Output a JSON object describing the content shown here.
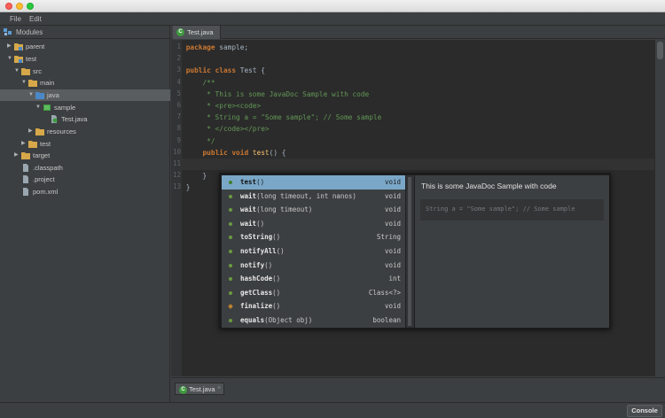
{
  "menubar": {
    "file": "File",
    "edit": "Edit"
  },
  "left_panel": {
    "title": "Modules",
    "tree": [
      {
        "label": "parent",
        "expanded": false,
        "icon": "module-folder-icon"
      },
      {
        "label": "test",
        "expanded": true,
        "icon": "module-folder-icon"
      },
      {
        "label": "src",
        "expanded": true,
        "icon": "folder-icon"
      },
      {
        "label": "main",
        "expanded": true,
        "icon": "folder-icon"
      },
      {
        "label": "java",
        "expanded": true,
        "icon": "source-folder-icon",
        "selected": true
      },
      {
        "label": "sample",
        "expanded": true,
        "icon": "package-icon"
      },
      {
        "label": "Test.java",
        "icon": "java-file-icon"
      },
      {
        "label": "resources",
        "expanded": false,
        "icon": "folder-icon"
      },
      {
        "label": "test",
        "expanded": false,
        "icon": "folder-icon"
      },
      {
        "label": "target",
        "expanded": false,
        "icon": "folder-icon"
      },
      {
        "label": ".classpath",
        "icon": "file-icon"
      },
      {
        "label": ".project",
        "icon": "file-icon"
      },
      {
        "label": "pom.xml",
        "icon": "file-icon"
      }
    ]
  },
  "editor": {
    "tab_label": "Test.java",
    "line_numbers": [
      "1",
      "2",
      "3",
      "4",
      "5",
      "6",
      "7",
      "8",
      "9",
      "10",
      "11",
      "12",
      "13"
    ],
    "lines": [
      "package sample;",
      "",
      "public class Test {",
      "    /**",
      "     * This is some JavaDoc Sample with code",
      "     * <pre><code>",
      "     * String a = \"Some sample\"; // Some sample",
      "     * </code></pre>",
      "     */",
      "    public void test() {",
      "",
      "    }",
      "}"
    ],
    "bottom_tab_label": "Test.java",
    "bottom_tab_close": "×"
  },
  "completion": {
    "items": [
      {
        "name": "test",
        "params": "()",
        "returns": "void",
        "selected": true
      },
      {
        "name": "wait",
        "params": "(long timeout, int nanos)",
        "returns": "void"
      },
      {
        "name": "wait",
        "params": "(long timeout)",
        "returns": "void"
      },
      {
        "name": "wait",
        "params": "()",
        "returns": "void"
      },
      {
        "name": "toString",
        "params": "()",
        "returns": "String"
      },
      {
        "name": "notifyAll",
        "params": "()",
        "returns": "void"
      },
      {
        "name": "notify",
        "params": "()",
        "returns": "void"
      },
      {
        "name": "hashCode",
        "params": "()",
        "returns": "int"
      },
      {
        "name": "getClass",
        "params": "()",
        "returns": "Class<?>"
      },
      {
        "name": "finalize",
        "params": "()",
        "returns": "void",
        "protected": true
      },
      {
        "name": "equals",
        "params": "(Object obj)",
        "returns": "boolean"
      }
    ],
    "doc_title": "This is some JavaDoc Sample with code",
    "doc_code": "String a = \"Some sample\"; // Some sample"
  },
  "statusbar": {
    "console_label": "Console"
  },
  "colors": {
    "background": "#3c3f41",
    "editor_bg": "#2b2b2b",
    "keyword": "#cc7832",
    "doc_comment": "#629755",
    "method": "#ffc66d",
    "selection": "#7aa7c7"
  }
}
